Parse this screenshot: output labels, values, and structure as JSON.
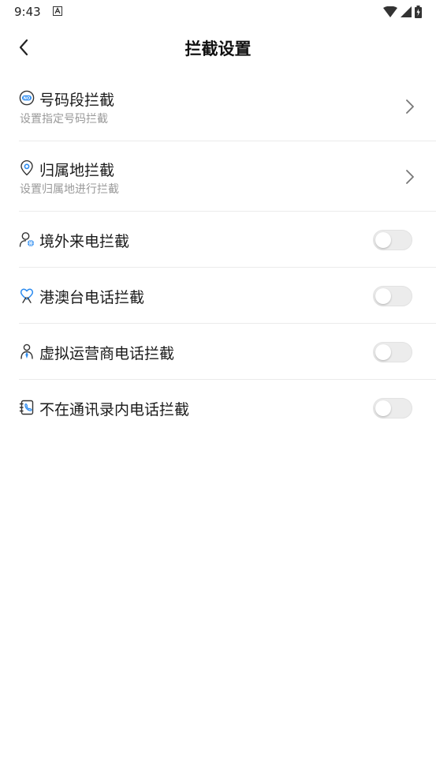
{
  "status_bar": {
    "time": "9:43"
  },
  "header": {
    "title": "拦截设置"
  },
  "items": [
    {
      "title": "号码段拦截",
      "subtitle": "设置指定号码拦截",
      "icon": "number-segment-icon",
      "control": "chevron"
    },
    {
      "title": "归属地拦截",
      "subtitle": "设置归属地进行拦截",
      "icon": "location-pin-icon",
      "control": "chevron"
    },
    {
      "title": "境外来电拦截",
      "icon": "overseas-caller-icon",
      "control": "toggle",
      "enabled": false
    },
    {
      "title": "港澳台电话拦截",
      "icon": "hk-mo-tw-icon",
      "control": "toggle",
      "enabled": false
    },
    {
      "title": "虚拟运营商电话拦截",
      "icon": "virtual-operator-icon",
      "control": "toggle",
      "enabled": false
    },
    {
      "title": "不在通讯录内电话拦截",
      "icon": "contacts-book-icon",
      "control": "toggle",
      "enabled": false
    }
  ],
  "colors": {
    "accent": "#2d8cf0",
    "icon_stroke": "#333333"
  }
}
